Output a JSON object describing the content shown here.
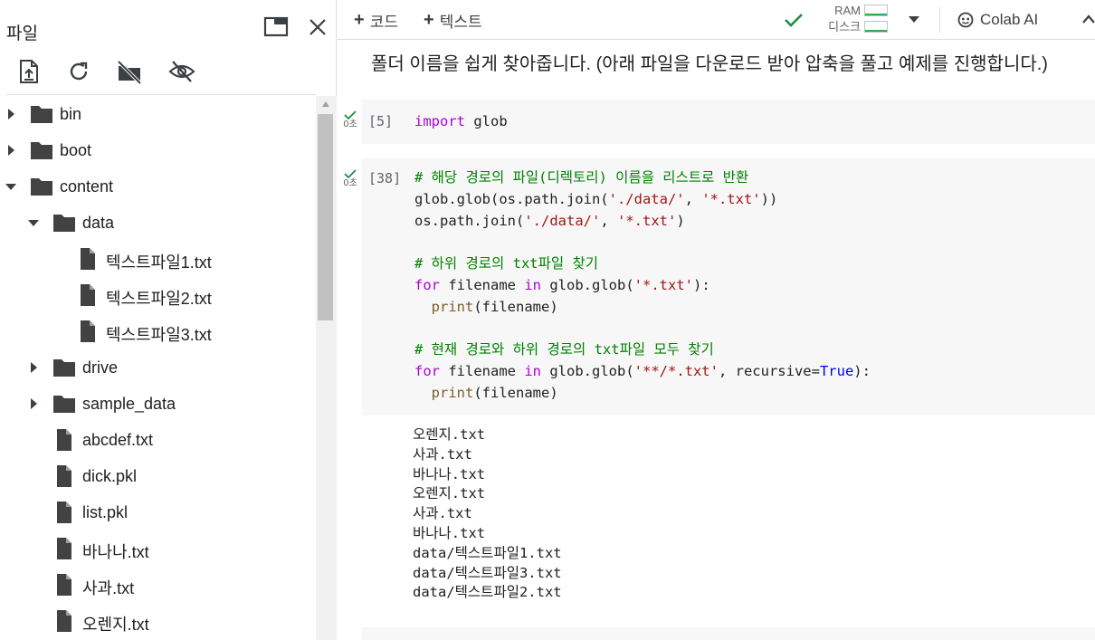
{
  "files_panel": {
    "title": "파일",
    "tree": [
      {
        "label": "bin",
        "kind": "folder",
        "depth": 0,
        "arrow": "right"
      },
      {
        "label": "boot",
        "kind": "folder",
        "depth": 0,
        "arrow": "right"
      },
      {
        "label": "content",
        "kind": "folder",
        "depth": 0,
        "arrow": "down"
      },
      {
        "label": "data",
        "kind": "folder",
        "depth": 1,
        "arrow": "down"
      },
      {
        "label": "텍스트파일1.txt",
        "kind": "file",
        "depth": 2
      },
      {
        "label": "텍스트파일2.txt",
        "kind": "file",
        "depth": 2
      },
      {
        "label": "텍스트파일3.txt",
        "kind": "file",
        "depth": 2
      },
      {
        "label": "drive",
        "kind": "folder",
        "depth": 1,
        "arrow": "right"
      },
      {
        "label": "sample_data",
        "kind": "folder",
        "depth": 1,
        "arrow": "right"
      },
      {
        "label": "abcdef.txt",
        "kind": "file",
        "depth": 1
      },
      {
        "label": "dick.pkl",
        "kind": "file",
        "depth": 1
      },
      {
        "label": "list.pkl",
        "kind": "file",
        "depth": 1
      },
      {
        "label": "바나나.txt",
        "kind": "file",
        "depth": 1
      },
      {
        "label": "사과.txt",
        "kind": "file",
        "depth": 1
      },
      {
        "label": "오렌지.txt",
        "kind": "file",
        "depth": 1
      }
    ]
  },
  "toolbar": {
    "add_code": "코드",
    "add_text": "텍스트",
    "ram_label": "RAM",
    "disk_label": "디스크",
    "colab_ai": "Colab AI"
  },
  "notebook": {
    "markdown_line": "폴더 이름을 쉽게 찾아줍니다. (아래 파일을 다운로드 받아 압축을 풀고 예제를 진행합니다.)",
    "cell1": {
      "exec_count": "[5]",
      "run_time": "0초"
    },
    "cell2": {
      "exec_count": "[38]",
      "run_time": "0초"
    },
    "code_text": {
      "import_kw": "import",
      "import_mod": " glob",
      "comment1": "# 해당 경로의 파일(디렉토리) 이름을 리스트로 반환",
      "comment2": "# 하위 경로의 txt파일 찾기",
      "comment3": "# 현재 경로와 하위 경로의 txt파일 모두 찾기"
    },
    "output": [
      "오렌지.txt",
      "사과.txt",
      "바나나.txt",
      "오렌지.txt",
      "사과.txt",
      "바나나.txt",
      "data/텍스트파일1.txt",
      "data/텍스트파일3.txt",
      "data/텍스트파일2.txt"
    ]
  },
  "colors": {
    "accent_green": "#34a853",
    "keyword": "#af00db",
    "string": "#a31515",
    "comment": "#008000",
    "function": "#795e26",
    "constant": "#0000ff"
  }
}
